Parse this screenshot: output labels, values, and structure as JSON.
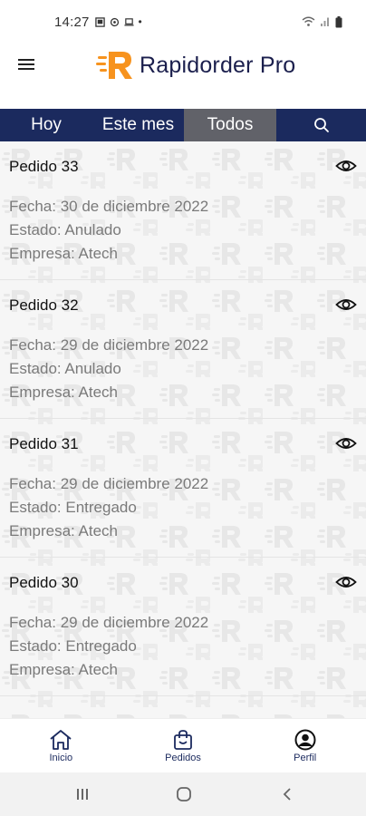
{
  "status_bar": {
    "time": "14:27",
    "dot": "•"
  },
  "header": {
    "app_name": "Rapidorder Pro",
    "menu_icon": "hamburger-icon",
    "logo_icon": "rapidorder-r-logo"
  },
  "tabs": [
    {
      "label": "Hoy",
      "selected": false
    },
    {
      "label": "Este mes",
      "selected": false
    },
    {
      "label": "Todos",
      "selected": true
    },
    {
      "label": "",
      "icon": "search-icon",
      "selected": false
    }
  ],
  "orders": [
    {
      "title": "Pedido 33",
      "fecha": "Fecha: 30 de diciembre 2022",
      "estado": "Estado: Anulado",
      "empresa": "Empresa: Atech"
    },
    {
      "title": "Pedido 32",
      "fecha": "Fecha: 29 de diciembre 2022",
      "estado": "Estado: Anulado",
      "empresa": "Empresa: Atech"
    },
    {
      "title": "Pedido 31",
      "fecha": "Fecha: 29 de diciembre 2022",
      "estado": "Estado: Entregado",
      "empresa": "Empresa: Atech"
    },
    {
      "title": "Pedido 30",
      "fecha": "Fecha: 29 de diciembre 2022",
      "estado": "Estado: Entregado",
      "empresa": "Empresa: Atech"
    }
  ],
  "bottom_nav": [
    {
      "label": "Inicio",
      "icon": "home-icon"
    },
    {
      "label": "Pedidos",
      "icon": "shopping-bag-icon"
    },
    {
      "label": "Perfil",
      "icon": "user-circle-icon"
    }
  ],
  "colors": {
    "primary": "#1b2a5e",
    "tab_selected": "#616269",
    "logo_orange": "#f7931e"
  }
}
